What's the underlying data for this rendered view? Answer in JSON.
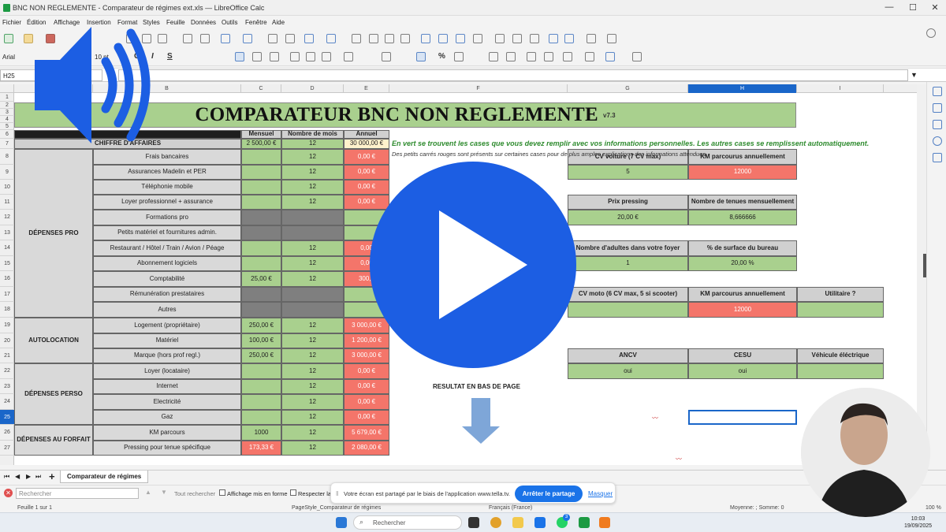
{
  "window": {
    "title": "BNC NON REGLEMENTE - Comparateur de régimes ext.xls — LibreOffice Calc",
    "controls": [
      "—",
      "☐",
      "✕"
    ]
  },
  "menu": [
    "Fichier",
    "Édition",
    "Affichage",
    "Insertion",
    "Format",
    "Styles",
    "Feuille",
    "Données",
    "Outils",
    "Fenêtre",
    "Aide"
  ],
  "toolbar": {
    "font_name": "Arial",
    "font_size": "10 pt",
    "bold": "G",
    "italic": "I",
    "underline": "S",
    "percent": "%"
  },
  "formula_bar": {
    "name_box": "H25",
    "content": ""
  },
  "columns": [
    "A",
    "B",
    "C",
    "D",
    "E",
    "F",
    "G",
    "H",
    "I"
  ],
  "selected_column": "H",
  "selected_row": "25",
  "rows": [
    "1",
    "2",
    "3",
    "4",
    "5",
    "6",
    "7",
    "8",
    "9",
    "10",
    "11",
    "12",
    "13",
    "14",
    "15",
    "16",
    "17",
    "18",
    "19",
    "20",
    "21",
    "22",
    "23",
    "24",
    "25",
    "26",
    "27"
  ],
  "sheet": {
    "banner_title": "COMPARATEUR BNC NON REGLEMENTE",
    "banner_version": "v7.3",
    "header_mensuel": "Mensuel",
    "header_nb_mois": "Nombre de mois",
    "header_annuel": "Annuel",
    "ca_label": "CHIFFRE D'AFFAIRES",
    "ca_mensuel": "2 500,00 €",
    "ca_mois": "12",
    "ca_annuel": "30 000,00 €",
    "groups": {
      "pro": "DÉPENSES PRO",
      "autolocation": "AUTOLOCATION",
      "perso": "DÉPENSES PERSO",
      "forfait": "DÉPENSES AU FORFAIT"
    },
    "items": [
      {
        "row": "8",
        "label": "Frais bancaires",
        "mensuel": "",
        "mois": "12",
        "annuel": "0,00 €"
      },
      {
        "row": "9",
        "label": "Assurances Madelin et PER",
        "mensuel": "",
        "mois": "12",
        "annuel": "0,00 €"
      },
      {
        "row": "10",
        "label": "Téléphonie mobile",
        "mensuel": "",
        "mois": "12",
        "annuel": "0,00 €"
      },
      {
        "row": "11",
        "label": "Loyer professionnel + assurance",
        "mensuel": "",
        "mois": "12",
        "annuel": "0,00 €"
      },
      {
        "row": "12",
        "label": "Formations pro",
        "mensuel": "",
        "mois": "",
        "annuel": ""
      },
      {
        "row": "13",
        "label": "Petits matériel et fournitures admin.",
        "mensuel": "",
        "mois": "",
        "annuel": ""
      },
      {
        "row": "14",
        "label": "Restaurant / Hôtel / Train / Avion / Péage",
        "mensuel": "",
        "mois": "12",
        "annuel": "0,00"
      },
      {
        "row": "15",
        "label": "Abonnement logiciels",
        "mensuel": "",
        "mois": "12",
        "annuel": "0,00"
      },
      {
        "row": "16",
        "label": "Comptabilité",
        "mensuel": "25,00 €",
        "mois": "12",
        "annuel": "300,0"
      },
      {
        "row": "17",
        "label": "Rémunération prestataires",
        "mensuel": "",
        "mois": "",
        "annuel": ""
      },
      {
        "row": "18",
        "label": "Autres",
        "mensuel": "",
        "mois": "",
        "annuel": ""
      },
      {
        "row": "19",
        "label": "Logement (propriétaire)",
        "mensuel": "250,00 €",
        "mois": "12",
        "annuel": "3 000,00 €"
      },
      {
        "row": "20",
        "label": "Matériel",
        "mensuel": "100,00 €",
        "mois": "12",
        "annuel": "1 200,00 €"
      },
      {
        "row": "21",
        "label": "Marque (hors prof regl.)",
        "mensuel": "250,00 €",
        "mois": "12",
        "annuel": "3 000,00 €"
      },
      {
        "row": "22",
        "label": "Loyer (locataire)",
        "mensuel": "",
        "mois": "12",
        "annuel": "0,00 €"
      },
      {
        "row": "23",
        "label": "Internet",
        "mensuel": "",
        "mois": "12",
        "annuel": "0,00 €"
      },
      {
        "row": "24",
        "label": "Electricité",
        "mensuel": "",
        "mois": "12",
        "annuel": "0,00 €"
      },
      {
        "row": "25",
        "label": "Gaz",
        "mensuel": "",
        "mois": "12",
        "annuel": "0,00 €"
      },
      {
        "row": "26",
        "label": "KM parcours",
        "mensuel": "1000",
        "mois": "12",
        "annuel": "5 679,00 €"
      },
      {
        "row": "27",
        "label": "Pressing pour tenue spécifique",
        "mensuel": "173,33 €",
        "mois": "12",
        "annuel": "2 080,00 €"
      }
    ],
    "note_green": "En vert se trouvent les cases que vous devez remplir avec vos informations personnelles. Les autres cases se remplissent automatiquement.",
    "note_small": "Des petits carrés rouges sont présents sur certaines cases pour de plus amples explications des informations attendues.",
    "cv_voiture_label": "CV voiture (7 CV max)",
    "cv_voiture_value": "5",
    "km_label": "KM parcourus annuellement",
    "km_value": "12000",
    "prix_pressing_label": "Prix pressing",
    "prix_pressing_value": "20,00 €",
    "tenues_label": "Nombre de tenues mensuellement",
    "tenues_value": "8,666666",
    "adultes_label": "Nombre d'adultes dans votre foyer",
    "adultes_value": "1",
    "surface_label": "% de surface du bureau",
    "surface_value": "20,00 %",
    "cv_moto_label": "CV moto (6 CV max, 5 si scooter)",
    "cv_moto_value": "",
    "km_moto_label": "KM parcourus annuellement",
    "km_moto_value": "12000",
    "utilitaire_label": "Utilitaire ?",
    "utilitaire_value": "",
    "ancv_label": "ANCV",
    "ancv_value": "oui",
    "cesu_label": "CESU",
    "cesu_value": "oui",
    "vehicule_label": "Véhicule éléctrique",
    "vehicule_value": "",
    "resultat": "RESULTAT EN BAS DE PAGE"
  },
  "sheet_tabs": {
    "active": "Comparateur de régimes",
    "add": "+"
  },
  "find_bar": {
    "placeholder": "Rechercher",
    "find_all": "Tout rechercher",
    "formatted_display": "Affichage mis en forme",
    "match_case": "Respecter la"
  },
  "share_bar": {
    "message": "Votre écran est partagé par le biais de l'application www.tella.tv.",
    "stop": "Arrêter le partage",
    "hide": "Masquer"
  },
  "status_bar": {
    "sheet": "Feuille 1 sur 1",
    "page_style": "PageStyle_Comparateur de régimes",
    "language": "Français (France)",
    "summary": "Moyenne: ; Somme: 0",
    "zoom": "100 %"
  },
  "taskbar": {
    "search_placeholder": "Rechercher",
    "time": "10:03",
    "date": "19/09/2025",
    "badge": "3"
  },
  "colors": {
    "accent_blue": "#1c5ee3",
    "input_green": "#a9d08e",
    "result_red": "#f4756a",
    "header_gray": "#d0d0d0"
  }
}
